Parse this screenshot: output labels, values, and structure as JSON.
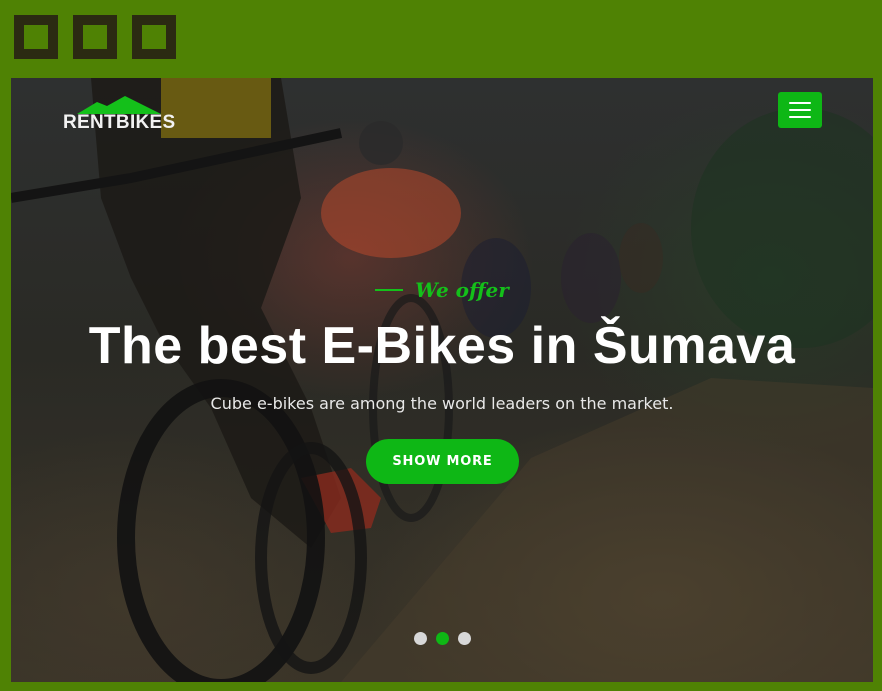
{
  "window": {
    "controls": [
      {
        "icon": "square-button-icon"
      },
      {
        "icon": "square-button-icon"
      },
      {
        "icon": "square-button-icon"
      }
    ]
  },
  "header": {
    "logo_text": "RENTBIKES",
    "logo_icon": "mountain-icon",
    "menu_icon": "hamburger-menu-icon"
  },
  "hero": {
    "eyebrow": "We offer",
    "headline": "The best E-Bikes in Šumava",
    "subline": "Cube e-bikes are among the world leaders on the market.",
    "cta_label": "SHOW MORE"
  },
  "carousel": {
    "slide_count": 3,
    "active_index": 1
  },
  "colors": {
    "frame_green": "#4f8204",
    "accent_green": "#0eb715",
    "eyebrow_green": "#14c01a"
  }
}
